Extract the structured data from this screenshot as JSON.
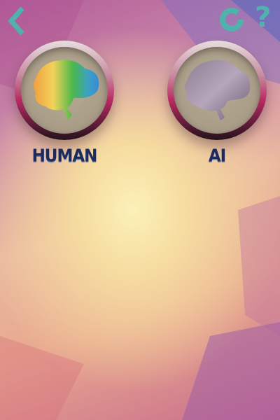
{
  "toolbar": {
    "back_icon": "chevron-left-icon",
    "restart_icon": "restart-ring-icon",
    "help_icon": "question-mark-icon",
    "help_glyph": "?",
    "icon_color": "#4fb3ad"
  },
  "choices": [
    {
      "label": "HUMAN",
      "icon": "colorful-brain-icon"
    },
    {
      "label": "AI",
      "icon": "gray-brain-icon"
    }
  ]
}
